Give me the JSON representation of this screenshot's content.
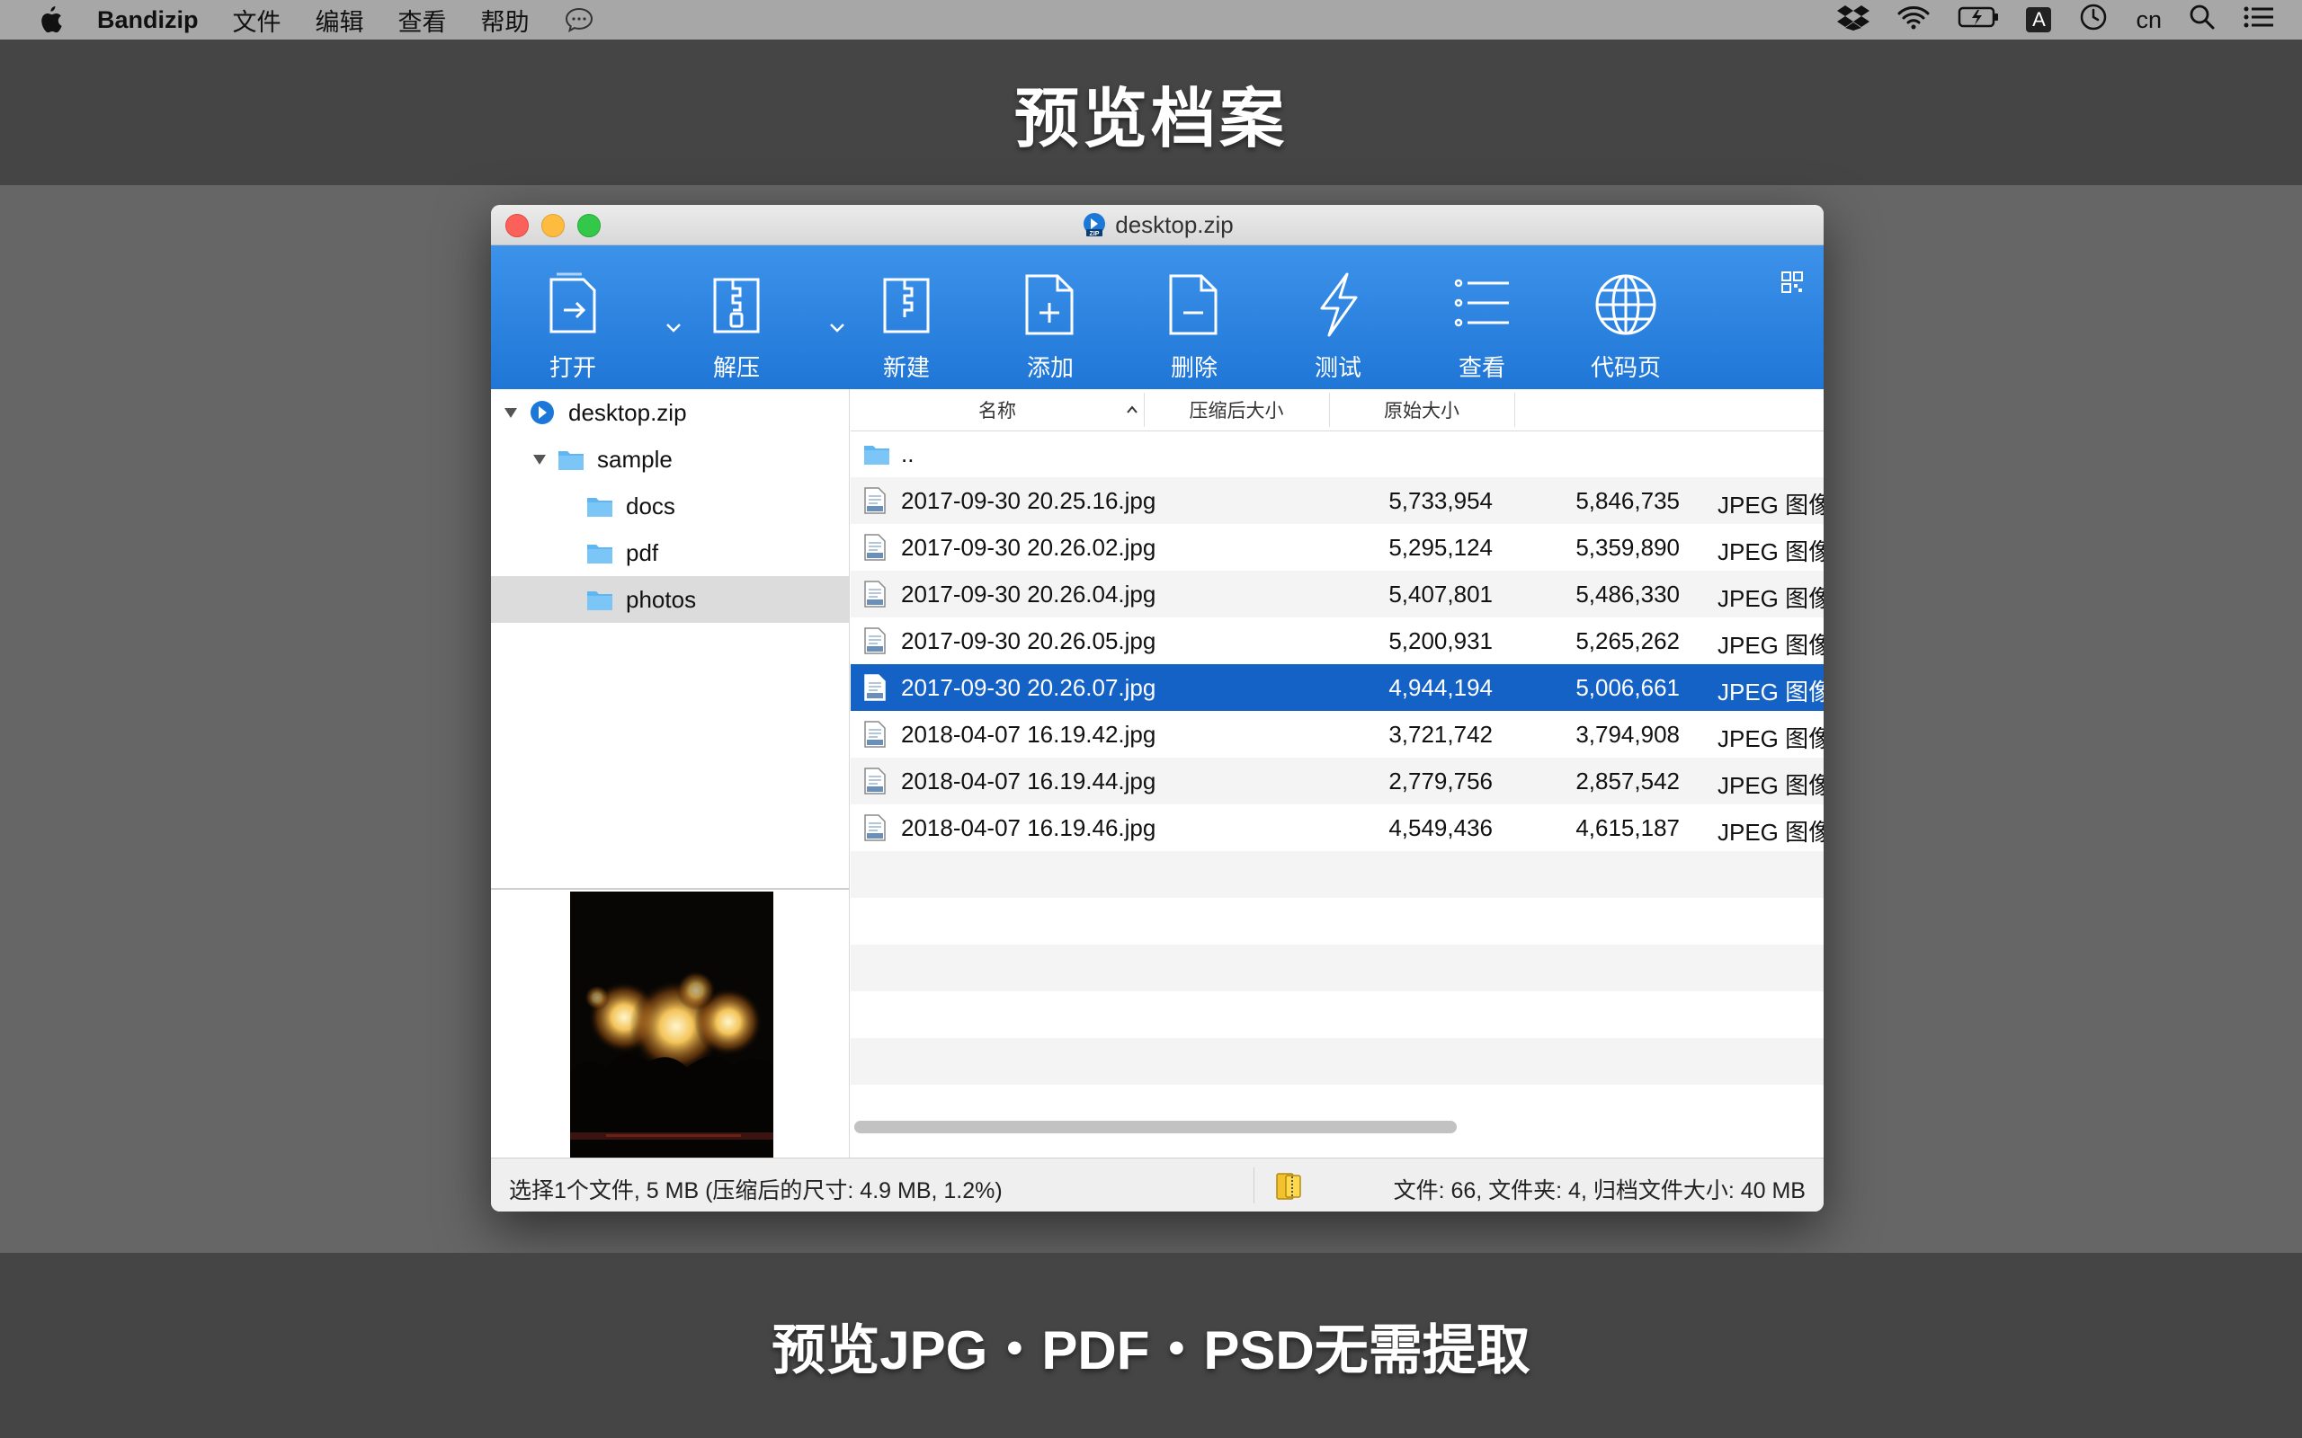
{
  "menubar": {
    "app_name": "Bandizip",
    "items": [
      "文件",
      "编辑",
      "查看",
      "帮助"
    ],
    "ime_label": "A",
    "lang": "cn"
  },
  "banner": {
    "title": "预览档案",
    "caption": "预览JPG・PDF・PSD无需提取"
  },
  "window": {
    "title": "desktop.zip"
  },
  "toolbar": {
    "open": "打开",
    "extract": "解压",
    "new": "新建",
    "add": "添加",
    "delete": "删除",
    "test": "测试",
    "view": "查看",
    "codepage": "代码页"
  },
  "tree": [
    {
      "label": "desktop.zip",
      "type": "zip",
      "level": 0,
      "expanded": true
    },
    {
      "label": "sample",
      "type": "folder",
      "level": 1,
      "expanded": true
    },
    {
      "label": "docs",
      "type": "folder",
      "level": 2
    },
    {
      "label": "pdf",
      "type": "folder",
      "level": 2
    },
    {
      "label": "photos",
      "type": "folder",
      "level": 2,
      "selected": true
    }
  ],
  "list": {
    "columns": {
      "name": "名称",
      "compressed": "压缩后大小",
      "original": "原始大小"
    },
    "sort": "name-ascending",
    "parent": "..",
    "files": [
      {
        "name": "2017-09-30 20.25.16.jpg",
        "compressed": "5,733,954",
        "original": "5,846,735",
        "type": "JPEG 图像"
      },
      {
        "name": "2017-09-30 20.26.02.jpg",
        "compressed": "5,295,124",
        "original": "5,359,890",
        "type": "JPEG 图像"
      },
      {
        "name": "2017-09-30 20.26.04.jpg",
        "compressed": "5,407,801",
        "original": "5,486,330",
        "type": "JPEG 图像"
      },
      {
        "name": "2017-09-30 20.26.05.jpg",
        "compressed": "5,200,931",
        "original": "5,265,262",
        "type": "JPEG 图像"
      },
      {
        "name": "2017-09-30 20.26.07.jpg",
        "compressed": "4,944,194",
        "original": "5,006,661",
        "type": "JPEG 图像",
        "selected": true
      },
      {
        "name": "2018-04-07 16.19.42.jpg",
        "compressed": "3,721,742",
        "original": "3,794,908",
        "type": "JPEG 图像"
      },
      {
        "name": "2018-04-07 16.19.44.jpg",
        "compressed": "2,779,756",
        "original": "2,857,542",
        "type": "JPEG 图像"
      },
      {
        "name": "2018-04-07 16.19.46.jpg",
        "compressed": "4,549,436",
        "original": "4,615,187",
        "type": "JPEG 图像"
      }
    ]
  },
  "status": {
    "left": "选择1个文件, 5 MB (压缩后的尺寸: 4.9 MB, 1.2%)",
    "right": "文件: 66, 文件夹: 4, 归档文件大小: 40 MB"
  },
  "colors": {
    "toolbar": "#2a82e0",
    "selection": "#1562c7",
    "folder": "#5fb6f2"
  }
}
